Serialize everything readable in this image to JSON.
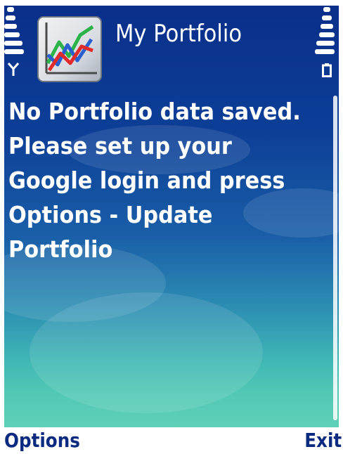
{
  "header": {
    "title": "My Portfolio"
  },
  "content": {
    "message": "No Portfolio data saved.\nPlease set up your\nGoogle login and press\nOptions - Update\nPortfolio"
  },
  "softkeys": {
    "left": "Options",
    "right": "Exit"
  },
  "icons": {
    "signal": "signal-strength-icon",
    "battery": "battery-level-icon",
    "app": "portfolio-chart-app-icon"
  },
  "colors": {
    "background_top": "#0a2f8a",
    "background_bottom": "#5fd0b8",
    "softkey_text": "#0b2b80",
    "text": "#ffffff"
  }
}
